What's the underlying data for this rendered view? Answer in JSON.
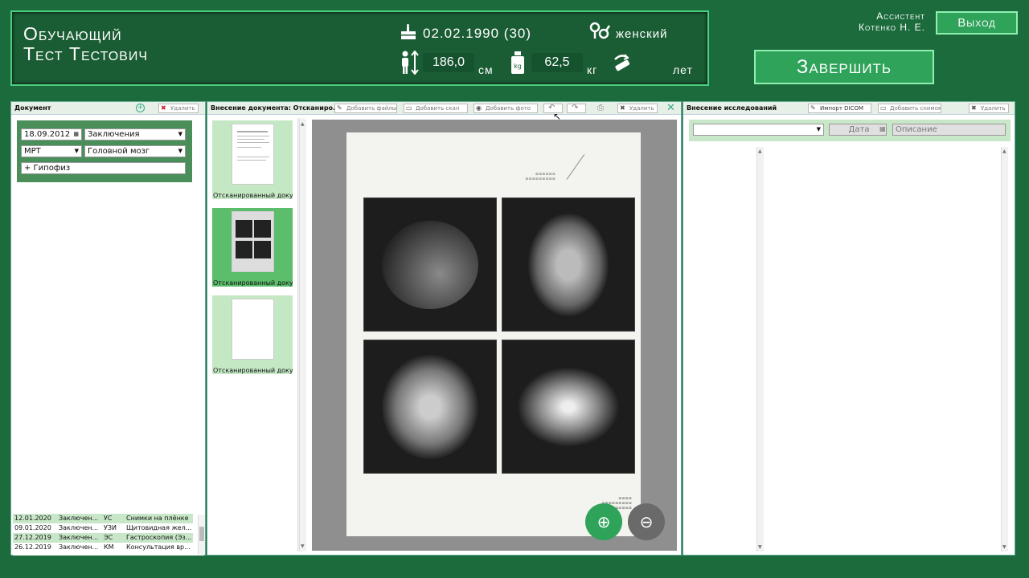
{
  "patient": {
    "line1": "Обучающий",
    "line2": "Тест Тестович",
    "dob": "02.02.1990 (30)",
    "gender": "женский",
    "height": "186,0",
    "height_unit": "см",
    "weight": "62,5",
    "weight_unit": "кг",
    "weight_icon": "kg",
    "age": "",
    "age_unit": "лет"
  },
  "user": {
    "role": "Ассистент",
    "name": "Котенко Н. Е."
  },
  "buttons": {
    "exit": "Выход",
    "finish": "Завершить"
  },
  "doc_panel": {
    "title": "Документ",
    "delete": "Удалить",
    "date": "18.09.2012",
    "type": "Заключения",
    "modality": "МРТ",
    "region": "Головной мозг",
    "tag": "+ Гипофиз"
  },
  "history": [
    {
      "date": "12.01.2020",
      "type": "Заключен...",
      "mod": "УС",
      "desc": "Снимки на плёнке"
    },
    {
      "date": "09.01.2020",
      "type": "Заключен...",
      "mod": "УЗИ",
      "desc": "Щитовидная жел..."
    },
    {
      "date": "27.12.2019",
      "type": "Заключен...",
      "mod": "ЭС",
      "desc": "Гастроскопия (Эз..."
    },
    {
      "date": "26.12.2019",
      "type": "Заключен...",
      "mod": "КМ",
      "desc": "Консультация вр..."
    }
  ],
  "entry_panel": {
    "title": "Внесение документа: Отсканиро...",
    "add_files": "Добавить файлы",
    "add_scan": "Добавить скан",
    "add_photo": "Добавить фото",
    "delete": "Удалить"
  },
  "thumbs": [
    {
      "caption": "Отсканированный докум..."
    },
    {
      "caption": "Отсканированный докум..."
    },
    {
      "caption": "Отсканированный докум..."
    }
  ],
  "study_panel": {
    "title": "Внесение исследований",
    "import": "Импорт DICOM",
    "add_image": "Добавить снимок",
    "delete": "Удалить",
    "date_ph": "Дата",
    "desc_ph": "Описание"
  },
  "colors": {
    "bg": "#1c6b3c",
    "accent": "#2fa35a",
    "selected": "#5cbd6a"
  }
}
